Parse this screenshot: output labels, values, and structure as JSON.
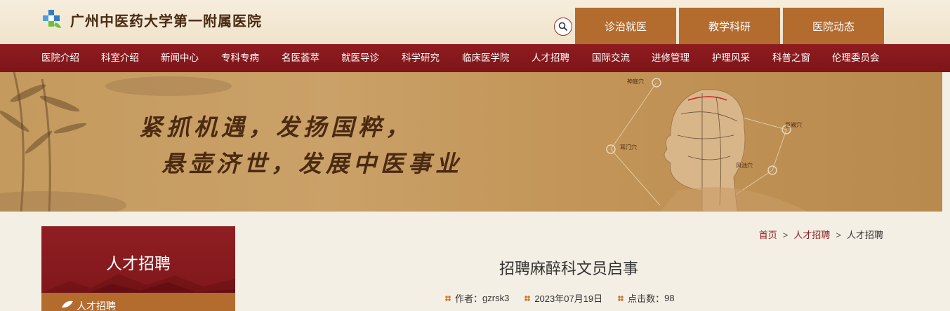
{
  "header": {
    "site_title": "广州中医药大学第一附属医院",
    "top_tabs": [
      "诊治就医",
      "教学科研",
      "医院动态"
    ]
  },
  "nav": {
    "items": [
      "医院介绍",
      "科室介绍",
      "新闻中心",
      "专科专病",
      "名医荟萃",
      "就医导诊",
      "科学研究",
      "临床医学院",
      "人才招聘",
      "国际交流",
      "进修管理",
      "护理风采",
      "科普之窗",
      "伦理委员会"
    ]
  },
  "banner": {
    "slogan_line1": "紧抓机遇，发扬国粹，",
    "slogan_line2": "悬壶济世，发展中医事业",
    "acupoints": [
      "神庭穴",
      "耳门穴",
      "风池穴",
      "巨阙穴"
    ]
  },
  "sidebar": {
    "title": "人才招聘",
    "sub_item": "人才招聘"
  },
  "breadcrumb": {
    "items": [
      "首页",
      "人才招聘",
      "人才招聘"
    ],
    "separator": ">"
  },
  "article": {
    "title": "招聘麻醉科文员启事",
    "author_label": "作者：",
    "author": "gzrsk3",
    "date": "2023年07月19日",
    "clicks_label": "点击数：",
    "clicks": "98"
  },
  "colors": {
    "nav_red": "#8e1c20",
    "tab_orange": "#b46b2e",
    "banner_tan": "#c49a5e"
  }
}
